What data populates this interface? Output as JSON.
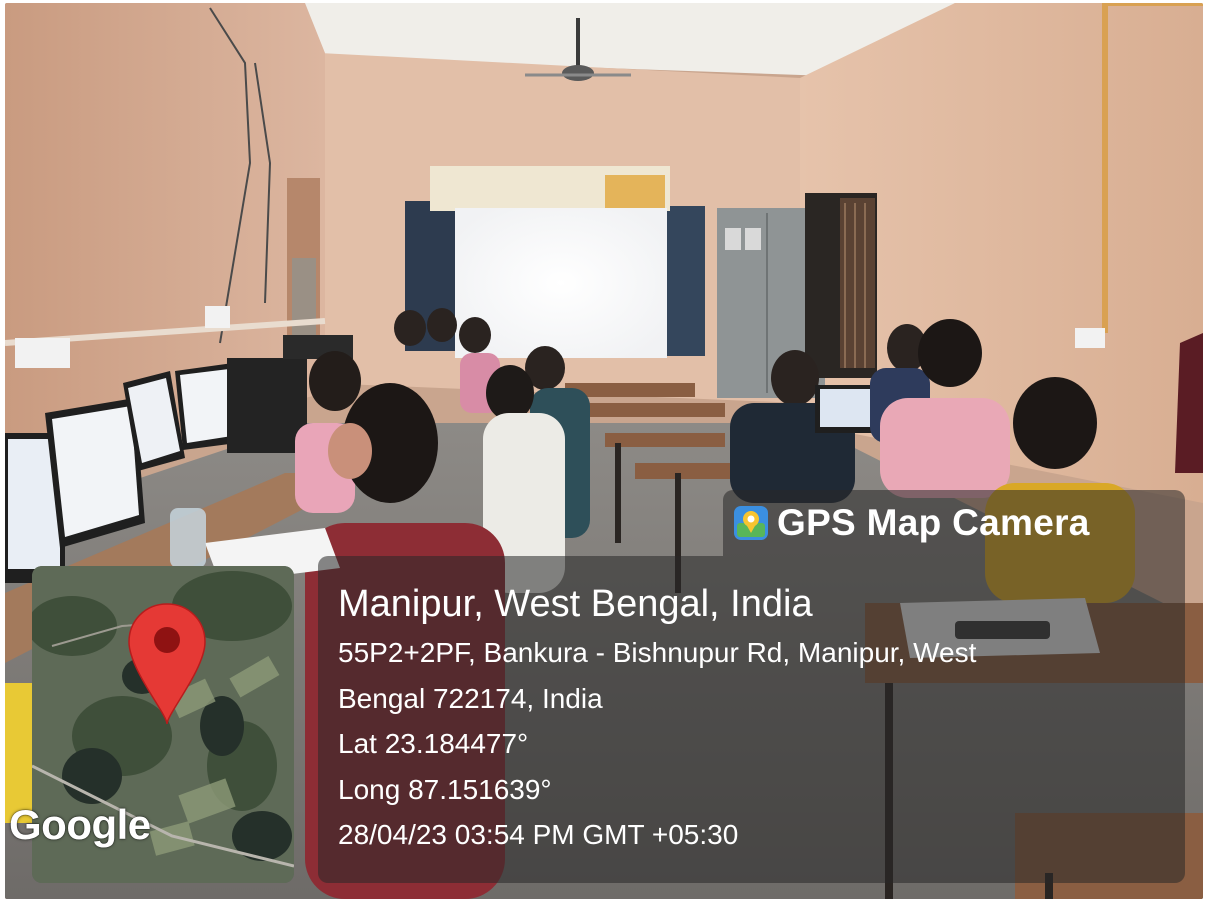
{
  "overlay": {
    "app_name": "GPS Map Camera",
    "place": "Manipur, West Bengal, India",
    "address_line1": "55P2+2PF, Bankura - Bishnupur Rd, Manipur, West",
    "address_line2": "Bengal 722174, India",
    "latitude": "Lat 23.184477°",
    "longitude": "Long 87.151639°",
    "datetime": "28/04/23 03:54 PM GMT +05:30"
  },
  "map": {
    "attribution": "Google",
    "marker_color": "#e53935"
  }
}
